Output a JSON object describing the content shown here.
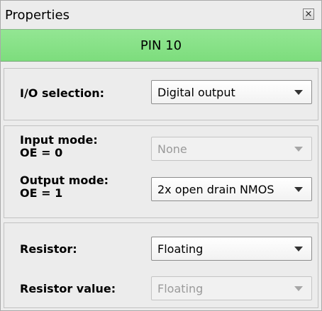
{
  "window": {
    "title": "Properties",
    "close_glyph": "✕"
  },
  "pin": {
    "label": "PIN 10",
    "color": "#7ddd7d"
  },
  "io_selection": {
    "label": "I/O selection:",
    "value": "Digital output",
    "enabled": true
  },
  "input_mode": {
    "label_line1": "Input mode:",
    "label_line2": "OE = 0",
    "value": "None",
    "enabled": false
  },
  "output_mode": {
    "label_line1": "Output mode:",
    "label_line2": "OE = 1",
    "value": "2x open drain NMOS",
    "enabled": true
  },
  "resistor": {
    "label": "Resistor:",
    "value": "Floating",
    "enabled": true
  },
  "resistor_value": {
    "label": "Resistor value:",
    "value": "Floating",
    "enabled": false
  },
  "icons": {
    "close": "close-icon",
    "dropdown": "chevron-down-icon"
  }
}
